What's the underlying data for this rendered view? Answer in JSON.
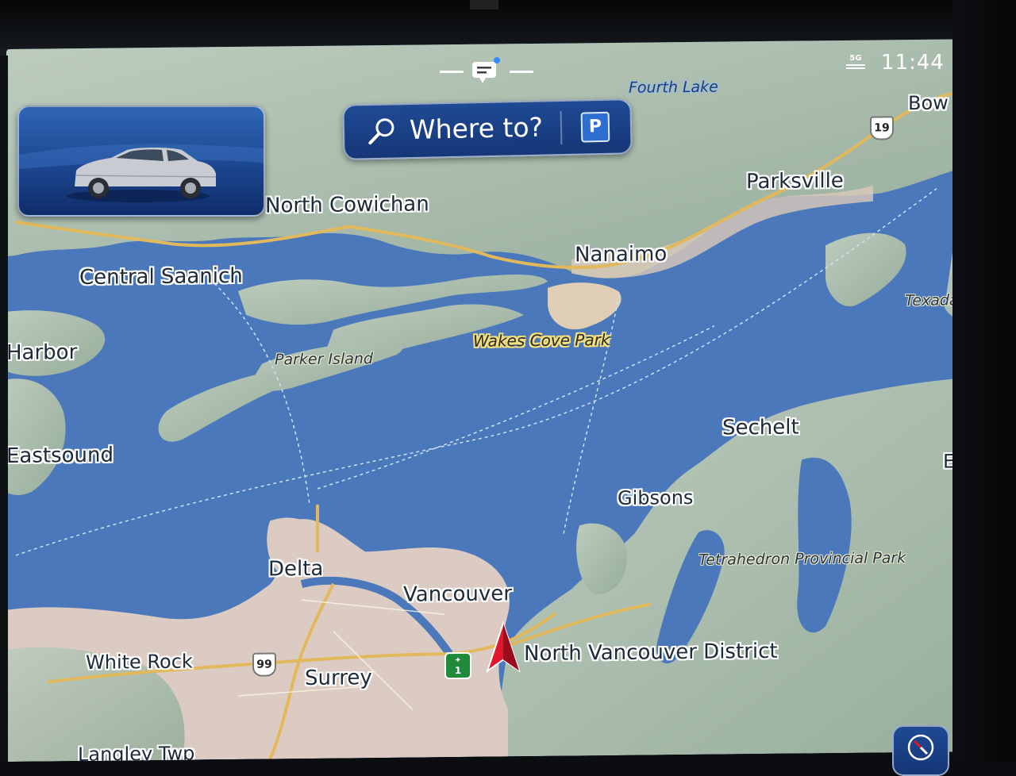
{
  "status_bar": {
    "clock": "11:44",
    "network": "5G"
  },
  "search": {
    "placeholder": "Where to?",
    "parking_label": "P"
  },
  "map": {
    "cities": [
      "North Cowichan",
      "Central Saanich",
      "Harbor",
      "Eastsound",
      "Nanaimo",
      "Parksville",
      "Bow",
      "Sechelt",
      "Gibsons",
      "Delta",
      "Vancouver",
      "White Rock",
      "Surrey",
      "North Vancouver District",
      "Langley Twp",
      "Texada",
      "E"
    ],
    "water_labels": [
      "Fourth Lake"
    ],
    "parks": [
      "Parker Island",
      "Wakes Cove Park",
      "Tetrahedron Provincial Park"
    ],
    "route_shields": [
      "19",
      "99",
      "1"
    ]
  },
  "colors": {
    "water": "#4a78bb",
    "land": "#a9bfae",
    "urban": "#dcc9c2",
    "road": "#e2b85c",
    "position_marker": "#e0182e"
  }
}
